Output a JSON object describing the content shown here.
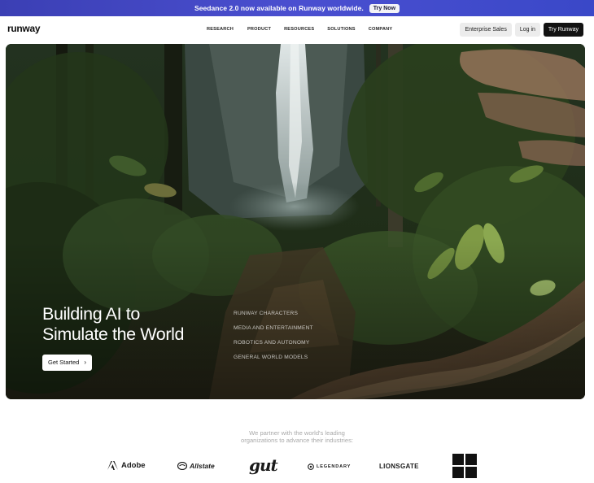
{
  "announcement": {
    "text": "Seedance 2.0 now available on Runway worldwide.",
    "button": "Try Now"
  },
  "nav": {
    "logo": "runway",
    "links": [
      "RESEARCH",
      "PRODUCT",
      "RESOURCES",
      "SOLUTIONS",
      "COMPANY"
    ],
    "buttons": {
      "enterprise": "Enterprise Sales",
      "login": "Log in",
      "try": "Try Runway"
    }
  },
  "hero": {
    "title_line1": "Building AI to",
    "title_line2": "Simulate the World",
    "cta": "Get Started",
    "cta_icon": "chevron-right-icon",
    "items": [
      "RUNWAY CHARACTERS",
      "MEDIA AND ENTERTAINMENT",
      "ROBOTICS AND AUTONOMY",
      "GENERAL WORLD MODELS"
    ]
  },
  "partners": {
    "line1": "We partner with the world's leading",
    "line2": "organizations to advance their industries:",
    "logos": [
      "Adobe",
      "Allstate",
      "gut",
      "LEGENDARY",
      "LIONSGATE"
    ]
  },
  "colors": {
    "announce_bg": "#4348c8",
    "dark_button": "#121212",
    "hero_foliage": "#1c2a16"
  }
}
